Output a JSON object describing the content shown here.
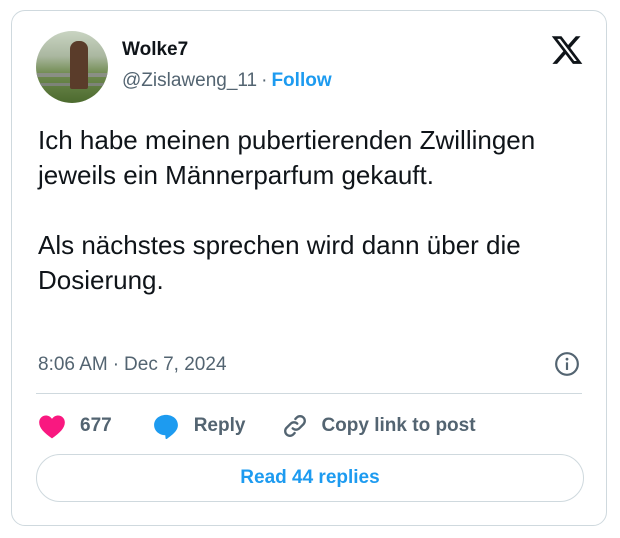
{
  "author": {
    "display_name": "Wolke7",
    "handle": "@Zislaweng_11",
    "separator": "·",
    "follow_label": "Follow",
    "avatar_icon": "profile-photo"
  },
  "post": {
    "text": "Ich habe meinen pubertierenden Zwillingen jeweils ein Männerparfum gekauft.\n\nAls nächstes sprechen wird dann über die Dosierung.",
    "time": "8:06 AM",
    "separator": "·",
    "date": "Dec 7, 2024"
  },
  "actions": {
    "like_count": "677",
    "reply_label": "Reply",
    "copy_link_label": "Copy link to post"
  },
  "read_replies_label": "Read 44 replies",
  "colors": {
    "accent": "#1d9bf0",
    "like": "#f91880",
    "muted": "#536471",
    "text": "#0f1419",
    "border": "#cfd9de"
  },
  "icons": [
    "x-logo-icon",
    "info-icon",
    "heart-icon",
    "reply-bubble-icon",
    "link-icon"
  ]
}
